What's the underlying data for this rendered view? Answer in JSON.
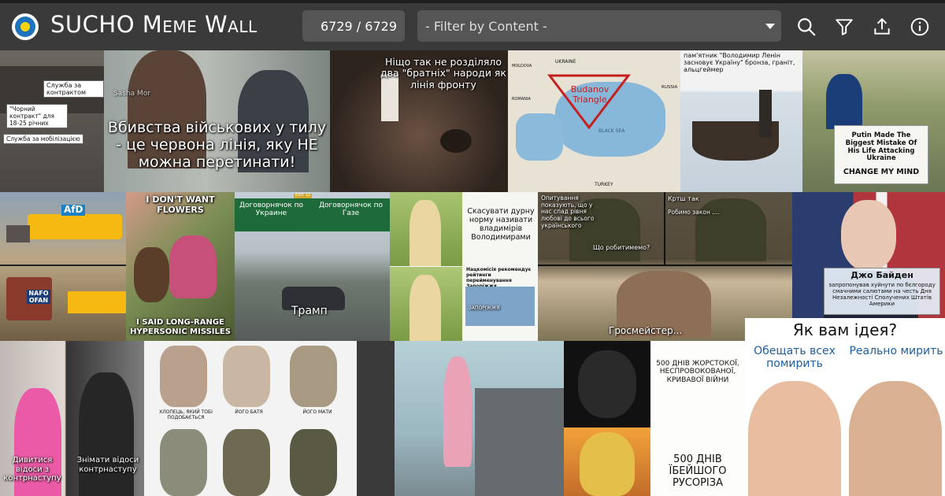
{
  "header": {
    "title": "SUCHO Meme Wall",
    "counter": "6729 / 6729",
    "filter_placeholder": "- Filter by Content -",
    "icons": [
      "search-icon",
      "filter-icon",
      "share-icon",
      "info-icon"
    ]
  },
  "memes": {
    "m1": {
      "a": "Служба за контрактом",
      "b": "\"Чорний контракт\" для 18-25 річних",
      "c": "Служба за мобілізацією"
    },
    "m2": {
      "watermark": "Sasha Mor",
      "caption": "Вбивства військових у тилу - це червона лінія, яку НЕ можна перетинати!"
    },
    "m3": {
      "caption": "Ніщо так не розділяло два \"братніх\" народи як лінія фронту"
    },
    "m4": {
      "caption": "Budanov Triangle",
      "sea": "BLACK SEA",
      "ukraine": "UKRAINE",
      "russia": "RUSSIA",
      "turkey": "TURKEY",
      "moldova": "MOLDOVA",
      "romania": "ROMANIA"
    },
    "m5": {
      "caption": "пам'ятник \"Володимир Ленін засновує Україну\" бронза, граніт, альцгеймер"
    },
    "m6": {
      "line1": "Putin Made The Biggest Mistake Of His Life Attacking Ukraine",
      "line2": "CHANGE MY MIND"
    },
    "m7": {
      "afd": "AfD",
      "nafo": "NAFO OFAN"
    },
    "m8": {
      "top": "I DON'T WANT FLOWERS",
      "bottom": "I SAID LONG-RANGE HYPERSONIC MISSILES"
    },
    "m9": {
      "sign_top": "EXIT 12",
      "left": "Договорнячок по Украине",
      "right": "Договорнячок по Газе",
      "car": "Трамп"
    },
    "m10": {
      "top": "Скасувати дурну норму називати владимірів Володимирами",
      "headline": "Нацкомісія рекомендує рейтинги перейменування Запоріжжя",
      "sign": "ЗАПОРІЖЖЯ"
    },
    "m11": {
      "a": "Опитування показують, що у нас спад рівня любові до всього українського",
      "b": "Що робитимемо?",
      "c": "Кртш так",
      "d": "Робимо закон ....",
      "caption": "Гросмейстер..."
    },
    "m12": {
      "name": "Джо Байден",
      "text": "запропонував хуйнути по бєлгороду смачними салютами на честь Дня Незалежності Сполучених Штатів Америки"
    },
    "m13": {
      "left": "Дивитися відоси з контрнаступу",
      "right": "Знімати відоси контрнаступу"
    },
    "m14": {
      "l1": "ХЛОПЕЦЬ, ЯКИЙ ТОБІ ПОДОБАЄТЬСЯ",
      "l2": "ЙОГО БАТЯ",
      "l3": "ЙОГО МАТИ"
    },
    "m16": {
      "top": "500 ДНІВ ЖОРСТОКОЇ, НЕСПРОВОКОВАНОЇ, КРИВАВОЇ ВІЙНИ",
      "bottom": "500 ДНІВ ЇБЕЙШОГО РУСОРІЗА"
    },
    "m17": {
      "title": "Як вам ідея?",
      "left": "Обещать всех помирить",
      "right": "Реально мирить"
    }
  },
  "colors": {
    "topbar": "#3a3a3a",
    "field": "#555555",
    "accent": "#1e73be"
  }
}
